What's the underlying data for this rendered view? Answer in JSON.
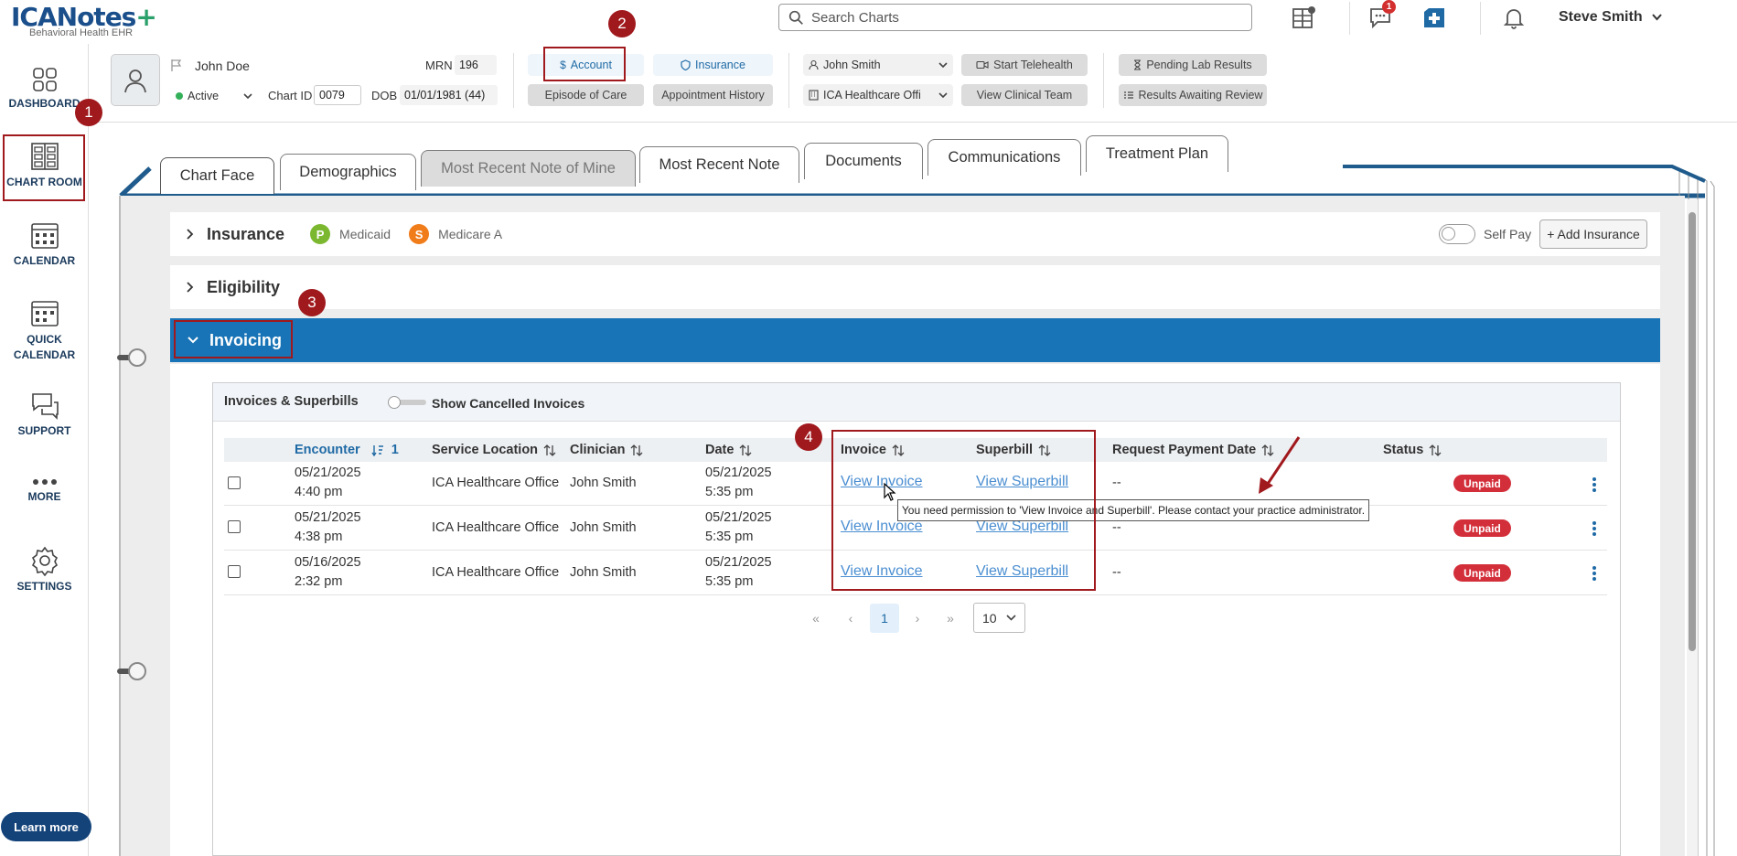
{
  "app": {
    "logo": "ICANotes",
    "logo_plus": "+",
    "logo_sub": "Behavioral Health EHR"
  },
  "topbar": {
    "search_placeholder": "Search Charts",
    "messages_badge": "1",
    "user_name": "Steve Smith"
  },
  "sidebar": {
    "items": [
      {
        "label": "DASHBOARD"
      },
      {
        "label": "CHART ROOM"
      },
      {
        "label": "CALENDAR"
      },
      {
        "label": "QUICK CALENDAR"
      },
      {
        "label": "SUPPORT"
      },
      {
        "label": "MORE"
      },
      {
        "label": "SETTINGS"
      }
    ],
    "learn_more": "Learn more"
  },
  "patient": {
    "name": "John Doe",
    "mrn_label": "MRN",
    "mrn": "196",
    "status": "Active",
    "chart_id_label": "Chart ID",
    "chart_id": "0079",
    "dob_label": "DOB",
    "dob": "01/01/1981 (44)"
  },
  "header_buttons": {
    "account": "Account",
    "insurance": "Insurance",
    "episode_of_care": "Episode of Care",
    "appointment_history": "Appointment History",
    "clinician": "John Smith",
    "location": "ICA Healthcare Offi",
    "start_telehealth": "Start Telehealth",
    "view_clinical_team": "View Clinical Team",
    "pending_lab_results": "Pending Lab Results",
    "results_awaiting_review": "Results Awaiting Review"
  },
  "tabs": [
    "Chart Face",
    "Demographics",
    "Most Recent Note of Mine",
    "Most Recent Note",
    "Documents",
    "Communications",
    "Treatment Plan"
  ],
  "sections": {
    "insurance": {
      "title": "Insurance",
      "plans": [
        {
          "badge": "P",
          "name": "Medicaid",
          "color": "#7cb82f"
        },
        {
          "badge": "S",
          "name": "Medicare A",
          "color": "#f07c1a"
        }
      ],
      "self_pay": "Self Pay",
      "add_insurance": "+ Add Insurance"
    },
    "eligibility": {
      "title": "Eligibility"
    },
    "invoicing": {
      "title": "Invoicing"
    }
  },
  "invoices": {
    "title": "Invoices & Superbills",
    "show_cancelled": "Show Cancelled Invoices",
    "columns": {
      "encounter": "Encounter",
      "sort_order": "1",
      "service_location": "Service Location",
      "clinician": "Clinician",
      "date": "Date",
      "invoice": "Invoice",
      "superbill": "Superbill",
      "request_payment_date": "Request Payment Date",
      "status": "Status"
    },
    "rows": [
      {
        "enc_date": "05/21/2025",
        "enc_time": "4:40 pm",
        "location": "ICA Healthcare Office",
        "clinician": "John Smith",
        "date": "05/21/2025",
        "time": "5:35 pm",
        "invoice": "View Invoice",
        "superbill": "View Superbill",
        "request_payment": "--",
        "status": "Unpaid"
      },
      {
        "enc_date": "05/21/2025",
        "enc_time": "4:38 pm",
        "location": "ICA Healthcare Office",
        "clinician": "John Smith",
        "date": "05/21/2025",
        "time": "5:35 pm",
        "invoice": "View Invoice",
        "superbill": "View Superbill",
        "request_payment": "--",
        "status": "Unpaid"
      },
      {
        "enc_date": "05/16/2025",
        "enc_time": "2:32 pm",
        "location": "ICA Healthcare Office",
        "clinician": "John Smith",
        "date": "05/21/2025",
        "time": "5:35 pm",
        "invoice": "View Invoice",
        "superbill": "View Superbill",
        "request_payment": "--",
        "status": "Unpaid"
      }
    ],
    "tooltip": "You need permission to 'View Invoice and Superbill'. Please contact your practice administrator.",
    "pagination": {
      "current_page": "1",
      "page_size": "10"
    }
  },
  "annotations": {
    "step1": "1",
    "step2": "2",
    "step3": "3",
    "step4": "4",
    "color": "#a0191d"
  }
}
